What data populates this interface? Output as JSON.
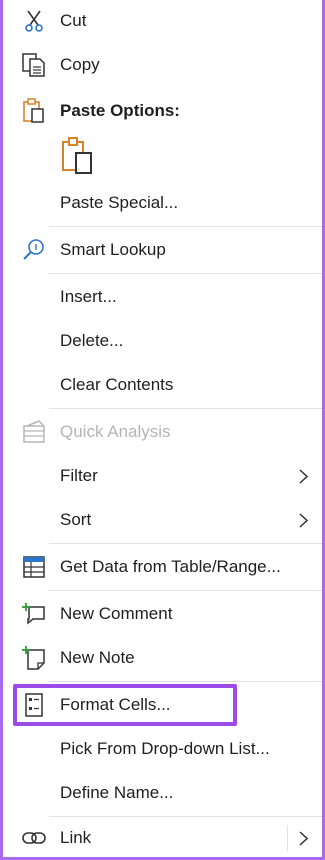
{
  "menu": {
    "cut": "Cut",
    "copy": "Copy",
    "paste_options": "Paste Options:",
    "paste_special": "Paste Special...",
    "smart_lookup": "Smart Lookup",
    "insert": "Insert...",
    "delete": "Delete...",
    "clear_contents": "Clear Contents",
    "quick_analysis": "Quick Analysis",
    "filter": "Filter",
    "sort": "Sort",
    "get_data": "Get Data from Table/Range...",
    "new_comment": "New Comment",
    "new_note": "New Note",
    "format_cells": "Format Cells...",
    "pick_from_dropdown": "Pick From Drop-down List...",
    "define_name": "Define Name...",
    "link": "Link"
  },
  "colors": {
    "frame_border": "#a769ef",
    "highlight_border": "#9b4ce8",
    "paste_icon": "#d8832a",
    "lookup_icon": "#2b76c9",
    "comment_plus": "#2e9d3a"
  },
  "icons": {
    "cut": "scissors-icon",
    "copy": "copy-icon",
    "paste": "clipboard-icon",
    "smart_lookup": "lightbulb-search-icon",
    "quick_analysis": "quick-analysis-icon",
    "get_data": "table-icon",
    "new_comment": "new-comment-icon",
    "new_note": "new-note-icon",
    "format_cells": "format-cells-icon",
    "link": "link-icon"
  }
}
